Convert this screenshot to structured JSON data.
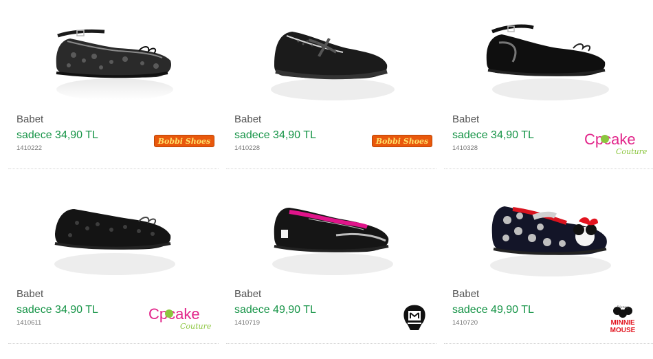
{
  "products": [
    {
      "name": "Babet",
      "price": "sadece 34,90 TL",
      "code": "1410222",
      "brand": "Bobbi Shoes",
      "brand_icon": "bobbi-shoes-logo"
    },
    {
      "name": "Babet",
      "price": "sadece 34,90 TL",
      "code": "1410228",
      "brand": "Bobbi Shoes",
      "brand_icon": "bobbi-shoes-logo"
    },
    {
      "name": "Babet",
      "price": "sadece 34,90 TL",
      "code": "1410328",
      "brand": "Cupcake Couture",
      "brand_icon": "cupcake-couture-logo"
    },
    {
      "name": "Babet",
      "price": "sadece 34,90 TL",
      "code": "1410611",
      "brand": "Cupcake Couture",
      "brand_icon": "cupcake-couture-logo"
    },
    {
      "name": "Babet",
      "price": "sadece 49,90 TL",
      "code": "1410719",
      "brand": "Monster High",
      "brand_icon": "monster-high-logo"
    },
    {
      "name": "Babet",
      "price": "sadece 49,90 TL",
      "code": "1410720",
      "brand": "Disney Minnie Mouse",
      "brand_icon": "minnie-mouse-logo"
    }
  ],
  "brands": {
    "bobbi": "Bobbi Shoes",
    "cupcake_main": "Cpcake",
    "cupcake_sub": "Couture",
    "disney": "Disney",
    "minnie1": "MINNIE",
    "minnie2": "MOUSE"
  },
  "colors": {
    "price": "#169447",
    "name": "#555555",
    "bobbi_bg": "#e9580c",
    "cupcake_pink": "#e2258a",
    "cupcake_green": "#8cc63f"
  }
}
